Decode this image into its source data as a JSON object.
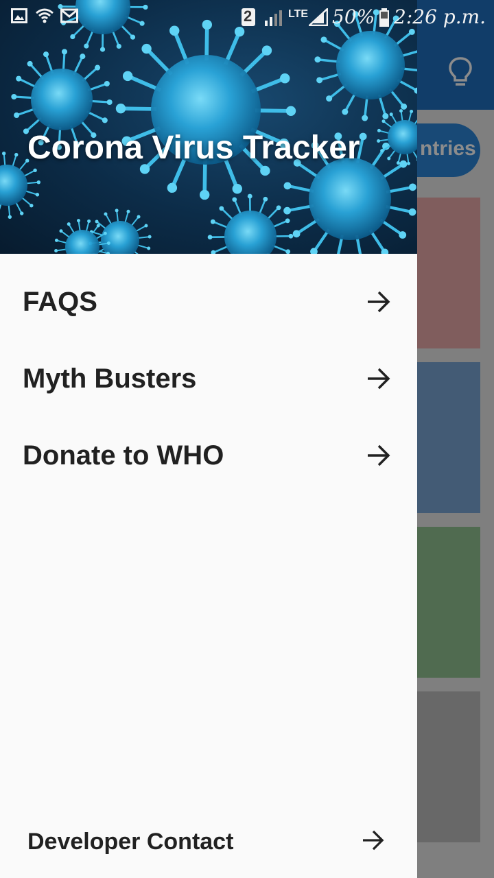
{
  "status_bar": {
    "sim_number": "2",
    "network_type": "LTE",
    "battery": "50%",
    "time": "2:26 p.m.",
    "icons": [
      "gallery-icon",
      "wifi-icon",
      "mail-icon",
      "sim-icon",
      "signal-icon",
      "battery-icon"
    ]
  },
  "background_app": {
    "header_action_icon": "lightbulb-icon",
    "tab_pill_partial_label": "ntries",
    "accent_color": "#1f6fbf",
    "card_colors": [
      "#e9a9a9",
      "#7aa6d6",
      "#93c393",
      "#bdbdbd"
    ]
  },
  "drawer": {
    "title": "Corona Virus Tracker",
    "items": [
      {
        "label": "FAQS",
        "icon": "arrow-right-icon"
      },
      {
        "label": "Myth Busters",
        "icon": "arrow-right-icon"
      },
      {
        "label": "Donate to WHO",
        "icon": "arrow-right-icon"
      }
    ],
    "footer_item": {
      "label": "Developer Contact",
      "icon": "arrow-right-icon"
    }
  }
}
